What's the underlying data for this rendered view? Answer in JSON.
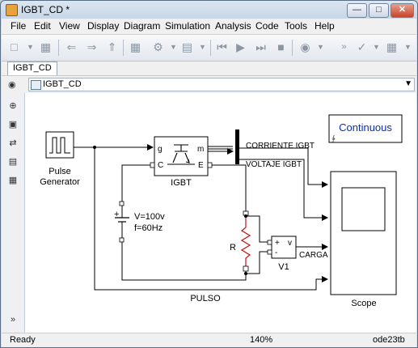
{
  "window": {
    "title": "IGBT_CD *"
  },
  "menu": [
    "File",
    "Edit",
    "View",
    "Display",
    "Diagram",
    "Simulation",
    "Analysis",
    "Code",
    "Tools",
    "Help"
  ],
  "tab": {
    "label": "IGBT_CD"
  },
  "address": {
    "path": "IGBT_CD"
  },
  "diagram": {
    "pulse_generator": {
      "line1": "Pulse",
      "line2": "Generator"
    },
    "igbt": {
      "label": "IGBT",
      "port_g": "g",
      "port_c": "C",
      "port_m": "m",
      "port_e": "E"
    },
    "source": {
      "voltage": "V=100v",
      "frequency": "f=60Hz",
      "plus": "+"
    },
    "resistor": {
      "label": "R"
    },
    "voltmeter": {
      "label": "V1",
      "symbol": "v",
      "plus": "+",
      "minus": "-"
    },
    "scope": {
      "label": "Scope"
    },
    "continuous": {
      "label": "Continuous"
    },
    "signals": {
      "current": "CORRIENTE IGBT",
      "voltage": "VOLTAJE IGBT",
      "load": "CARGA",
      "pulse": "PULSO"
    }
  },
  "status": {
    "state": "Ready",
    "zoom": "140%",
    "solver": "ode23tb"
  }
}
